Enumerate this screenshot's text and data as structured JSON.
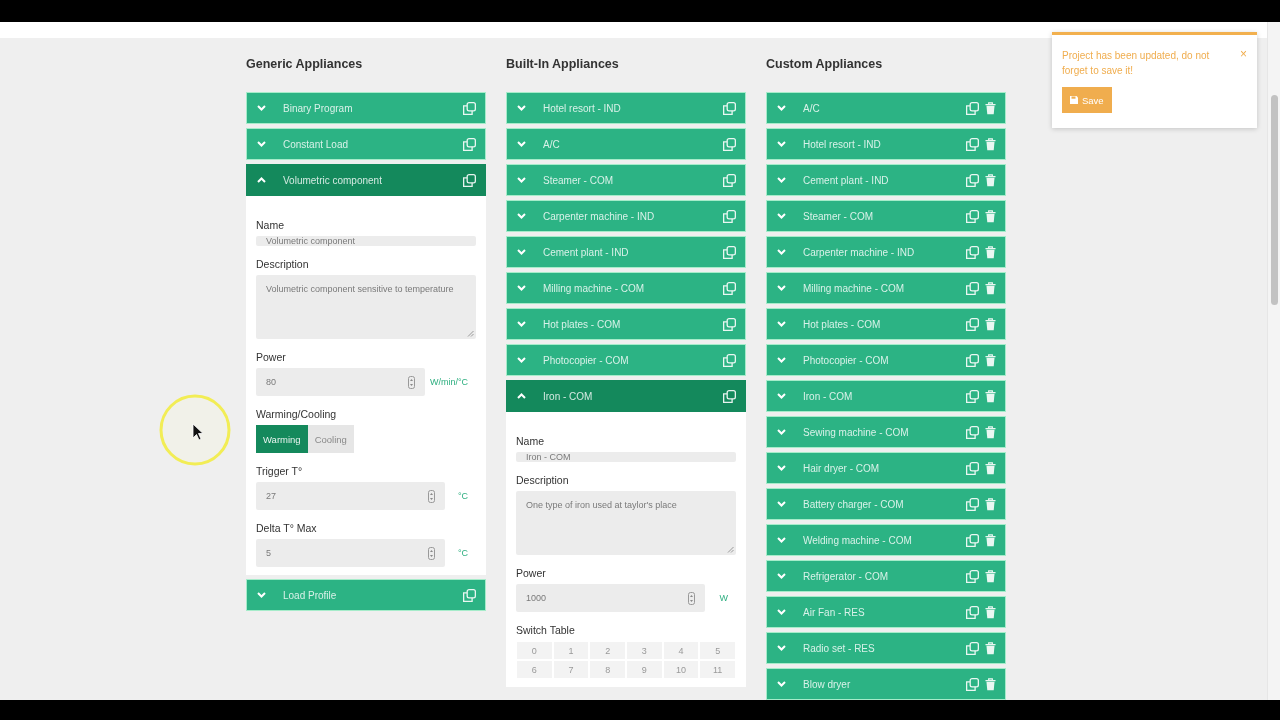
{
  "columns": [
    {
      "title": "Generic Appliances",
      "deletable": false,
      "items": [
        {
          "label": "Binary Program",
          "expanded": false
        },
        {
          "label": "Constant Load",
          "expanded": false
        },
        {
          "label": "Volumetric component",
          "expanded": true,
          "form": [
            {
              "kind": "text",
              "label": "Name",
              "value": "Volumetric component"
            },
            {
              "kind": "textarea",
              "label": "Description",
              "value": "Volumetric component sensitive to temperature"
            },
            {
              "kind": "number",
              "label": "Power",
              "value": "80",
              "unit": "W/min/°C"
            },
            {
              "kind": "toggle",
              "label": "Warming/Cooling",
              "options": [
                {
                  "label": "Warming",
                  "selected": true
                },
                {
                  "label": "Cooling",
                  "selected": false
                }
              ]
            },
            {
              "kind": "number",
              "label": "Trigger T°",
              "value": "27",
              "unit": "°C"
            },
            {
              "kind": "number",
              "label": "Delta T° Max",
              "value": "5",
              "unit": "°C"
            }
          ]
        },
        {
          "label": "Load Profile",
          "expanded": false
        }
      ]
    },
    {
      "title": "Built-In Appliances",
      "deletable": false,
      "items": [
        {
          "label": "Hotel resort - IND",
          "expanded": false
        },
        {
          "label": "A/C",
          "expanded": false
        },
        {
          "label": "Steamer - COM",
          "expanded": false
        },
        {
          "label": "Carpenter machine - IND",
          "expanded": false
        },
        {
          "label": "Cement plant - IND",
          "expanded": false
        },
        {
          "label": "Milling machine - COM",
          "expanded": false
        },
        {
          "label": "Hot plates - COM",
          "expanded": false
        },
        {
          "label": "Photocopier - COM",
          "expanded": false
        },
        {
          "label": "Iron - COM",
          "expanded": true,
          "form": [
            {
              "kind": "text",
              "label": "Name",
              "value": "Iron - COM"
            },
            {
              "kind": "textarea",
              "label": "Description",
              "value": "One type of iron used at taylor's place"
            },
            {
              "kind": "number",
              "label": "Power",
              "value": "1000",
              "unit": "W"
            },
            {
              "kind": "grid",
              "label": "Switch Table",
              "rows": [
                [
                  "0",
                  "1",
                  "2",
                  "3",
                  "4",
                  "5"
                ],
                [
                  "6",
                  "7",
                  "8",
                  "9",
                  "10",
                  "11"
                ]
              ]
            }
          ]
        }
      ]
    },
    {
      "title": "Custom Appliances",
      "deletable": true,
      "items": [
        {
          "label": "A/C",
          "expanded": false
        },
        {
          "label": "Hotel resort - IND",
          "expanded": false
        },
        {
          "label": "Cement plant - IND",
          "expanded": false
        },
        {
          "label": "Steamer - COM",
          "expanded": false
        },
        {
          "label": "Carpenter machine - IND",
          "expanded": false
        },
        {
          "label": "Milling machine - COM",
          "expanded": false
        },
        {
          "label": "Hot plates - COM",
          "expanded": false
        },
        {
          "label": "Photocopier - COM",
          "expanded": false
        },
        {
          "label": "Iron - COM",
          "expanded": false
        },
        {
          "label": "Sewing machine - COM",
          "expanded": false
        },
        {
          "label": "Hair dryer - COM",
          "expanded": false
        },
        {
          "label": "Battery charger - COM",
          "expanded": false
        },
        {
          "label": "Welding machine - COM",
          "expanded": false
        },
        {
          "label": "Refrigerator - COM",
          "expanded": false
        },
        {
          "label": "Air Fan - RES",
          "expanded": false
        },
        {
          "label": "Radio set - RES",
          "expanded": false
        },
        {
          "label": "Blow dryer",
          "expanded": false
        }
      ]
    }
  ],
  "notification": {
    "message": "Project has been updated, do not forget to save it!",
    "close": "×",
    "button": "Save"
  }
}
